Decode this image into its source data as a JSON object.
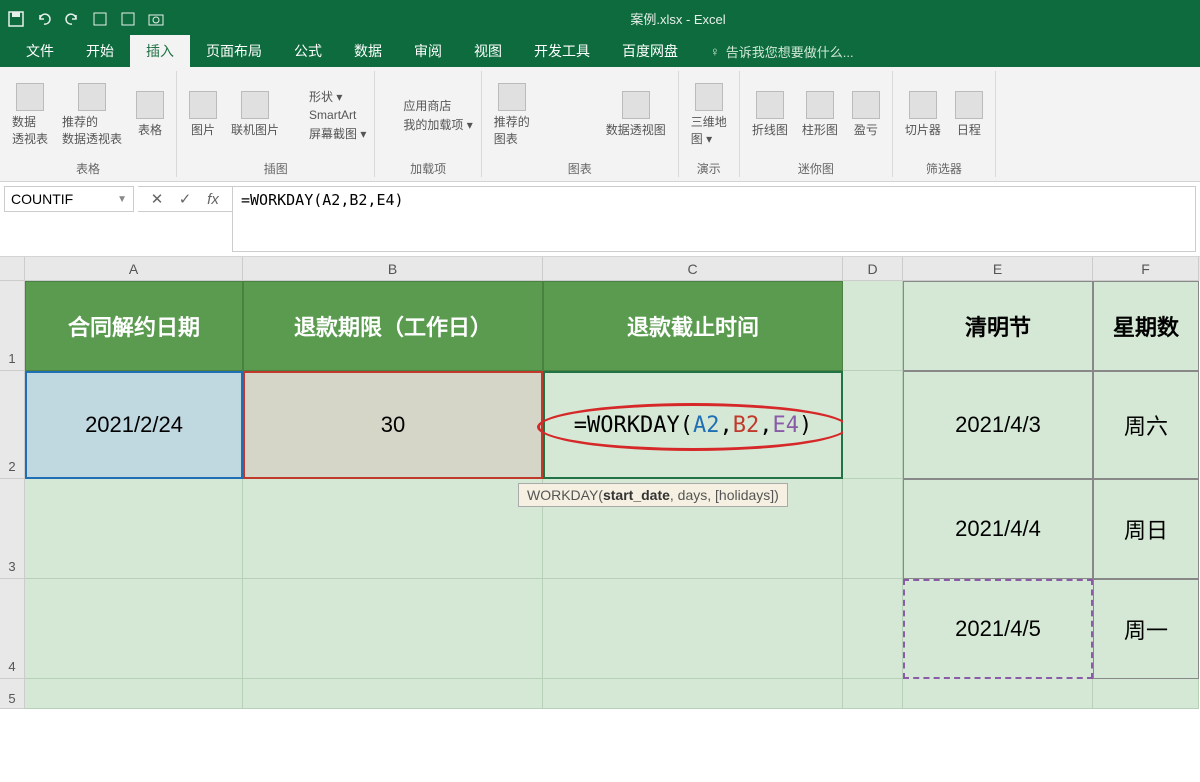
{
  "app": {
    "title": "案例.xlsx - Excel"
  },
  "tabs": {
    "file": "文件",
    "home": "开始",
    "insert": "插入",
    "layout": "页面布局",
    "formula": "公式",
    "data": "数据",
    "review": "审阅",
    "view": "视图",
    "developer": "开发工具",
    "baidu": "百度网盘",
    "tellme": "告诉我您想要做什么..."
  },
  "ribbon": {
    "tables": {
      "pivot": "数据\n透视表",
      "recommended": "推荐的\n数据透视表",
      "table": "表格",
      "group": "表格"
    },
    "illustrations": {
      "pictures": "图片",
      "online": "联机图片",
      "shapes": "形状 ▾",
      "smartart": "SmartArt",
      "screenshot": "屏幕截图 ▾",
      "group": "插图"
    },
    "addins": {
      "store": "应用商店",
      "myaddins": "我的加载项 ▾",
      "group": "加载项"
    },
    "charts": {
      "recommended": "推荐的\n图表",
      "pivotchart": "数据透视图",
      "threed": "三维地\n图 ▾",
      "group": "图表",
      "tours": "演示"
    },
    "sparklines": {
      "line": "折线图",
      "column": "柱形图",
      "winloss": "盈亏",
      "group": "迷你图"
    },
    "filters": {
      "slicer": "切片器",
      "timeline": "日程",
      "group": "筛选器"
    }
  },
  "formulabar": {
    "namebox": "COUNTIF",
    "formula": "=WORKDAY(A2,B2,E4)"
  },
  "columns": [
    "A",
    "B",
    "C",
    "D",
    "E",
    "F"
  ],
  "rows": [
    "1",
    "2",
    "3",
    "4",
    "5"
  ],
  "cells": {
    "A1": "合同解约日期",
    "B1": "退款期限（工作日）",
    "C1": "退款截止时间",
    "E1": "清明节",
    "F1": "星期数",
    "A2": "2021/2/24",
    "B2": "30",
    "C2_formula": {
      "prefix": "=WORKDAY(",
      "arg1": "A2",
      "arg2": "B2",
      "arg3": "E4",
      "suffix": ")"
    },
    "E2": "2021/4/3",
    "F2": "周六",
    "E3": "2021/4/4",
    "F3": "周日",
    "E4": "2021/4/5",
    "F4": "周一"
  },
  "tooltip": {
    "fn": "WORKDAY(",
    "bold": "start_date",
    "rest": ", days, [holidays])"
  }
}
